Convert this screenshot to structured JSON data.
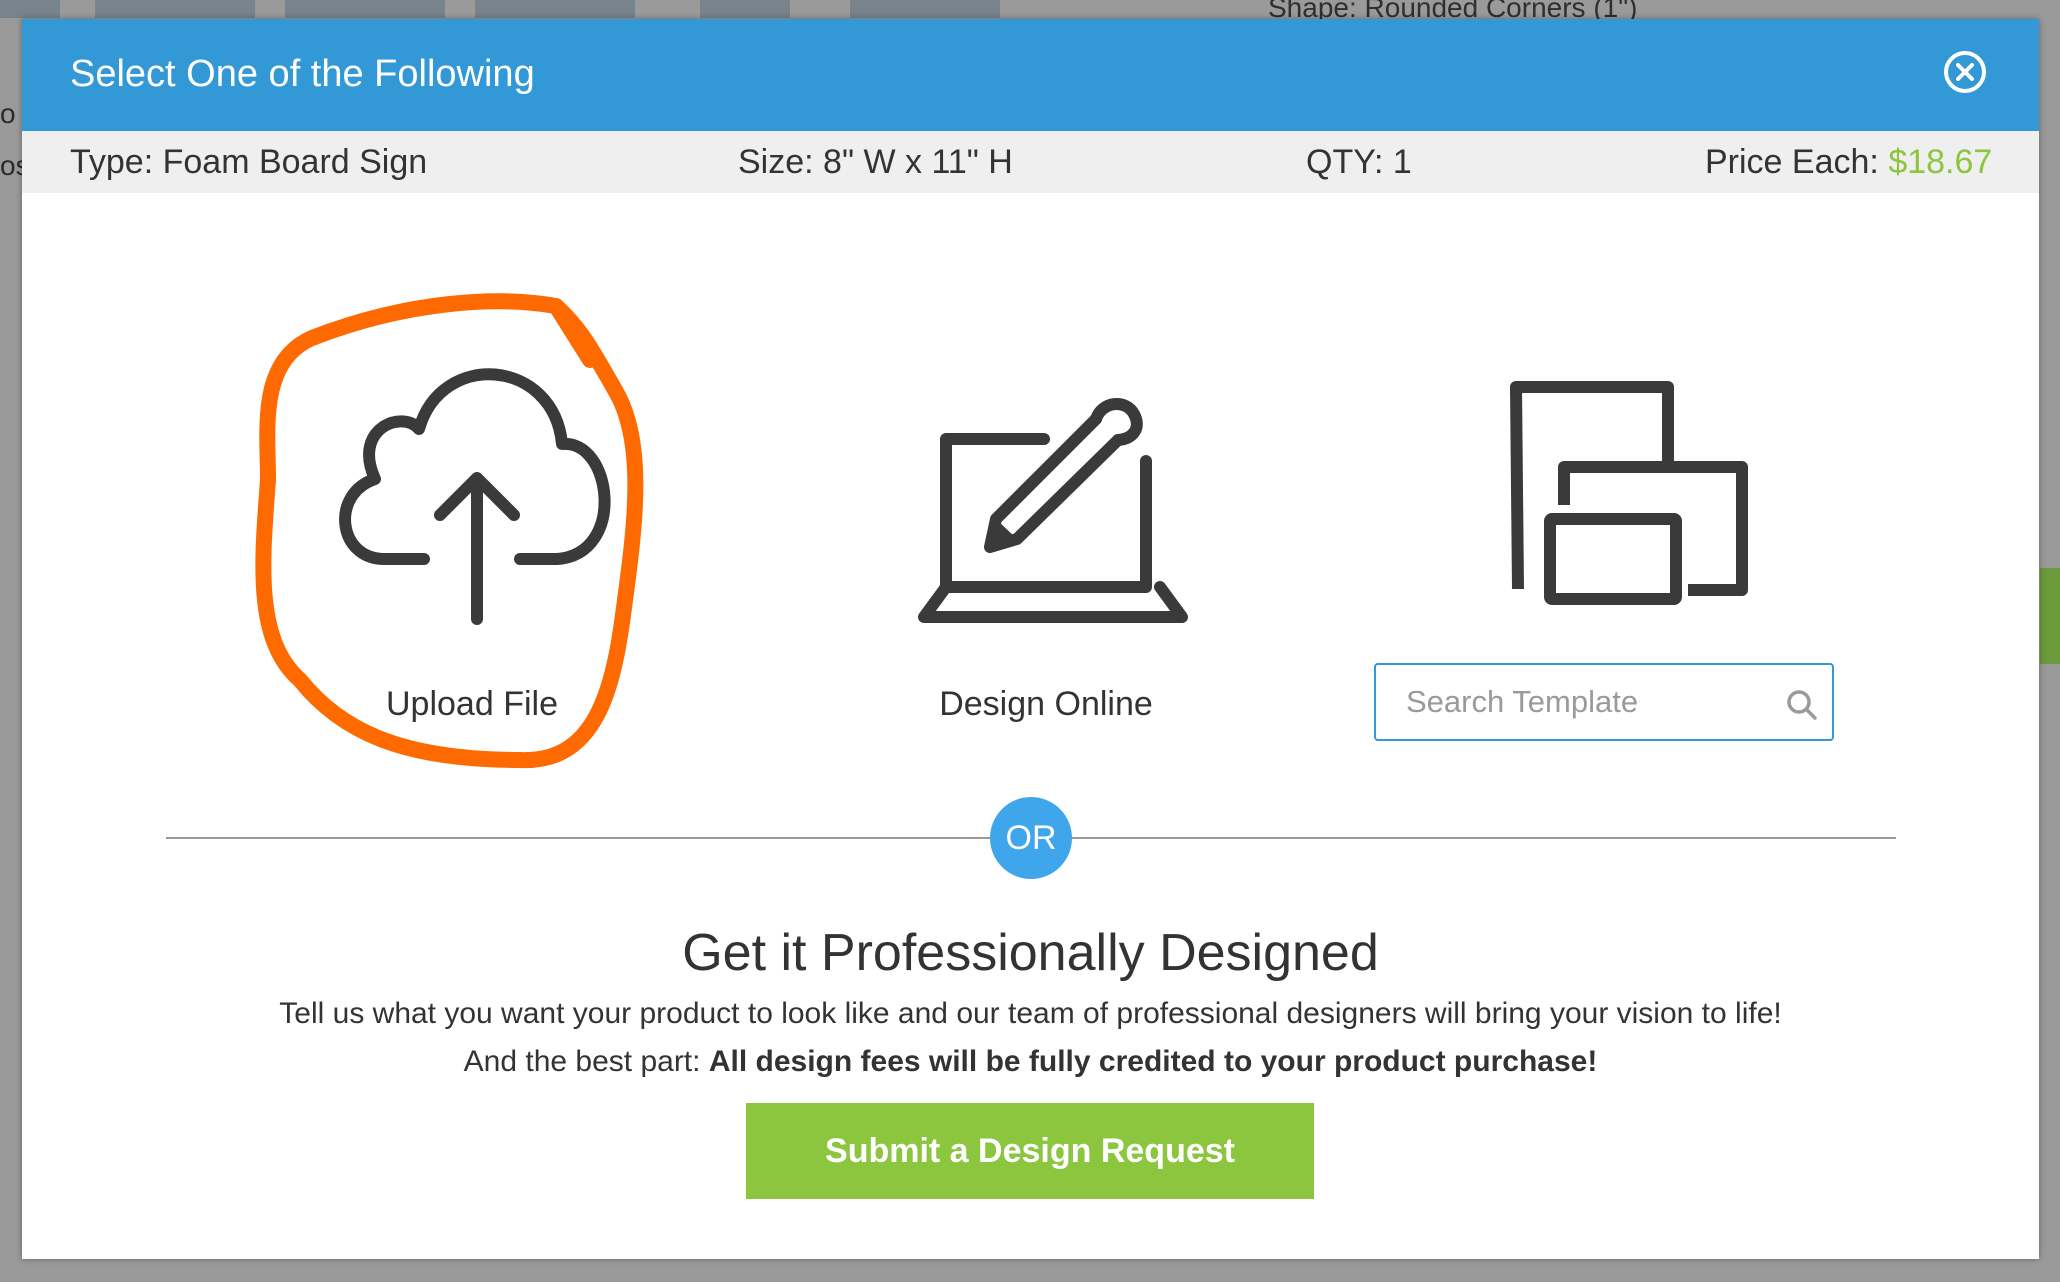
{
  "background": {
    "shape_text": "Shape: Rounded Corners (1\")",
    "left_fragment_1": "o",
    "left_fragment_2": "os"
  },
  "modal": {
    "title": "Select One of the Following",
    "close_icon": "close-circle-icon"
  },
  "info_bar": {
    "type": "Type: Foam Board Sign",
    "size": "Size: 8\" W x 11\" H",
    "qty": "QTY: 1",
    "price_label": "Price Each:",
    "price_value": "$18.67"
  },
  "options": {
    "upload": {
      "label": "Upload File",
      "icon": "cloud-upload-icon"
    },
    "design": {
      "label": "Design Online",
      "icon": "laptop-pencil-icon"
    },
    "template": {
      "icon": "templates-icon",
      "search_placeholder": "Search Template",
      "search_value": ""
    }
  },
  "or_label": "OR",
  "professional": {
    "title": "Get it Professionally Designed",
    "line1": "Tell us what you want your product to look like and our team of professional designers will bring your vision to life!",
    "line2_prefix": "And the best part:",
    "line2_bold": "All design fees will be fully credited to your product purchase!",
    "button_label": "Submit a Design Request"
  },
  "colors": {
    "header": "#3399d6",
    "price": "#8cc63f",
    "button": "#8cc63f",
    "or_badge": "#3fa6ec",
    "annotation": "#ff6a00"
  }
}
